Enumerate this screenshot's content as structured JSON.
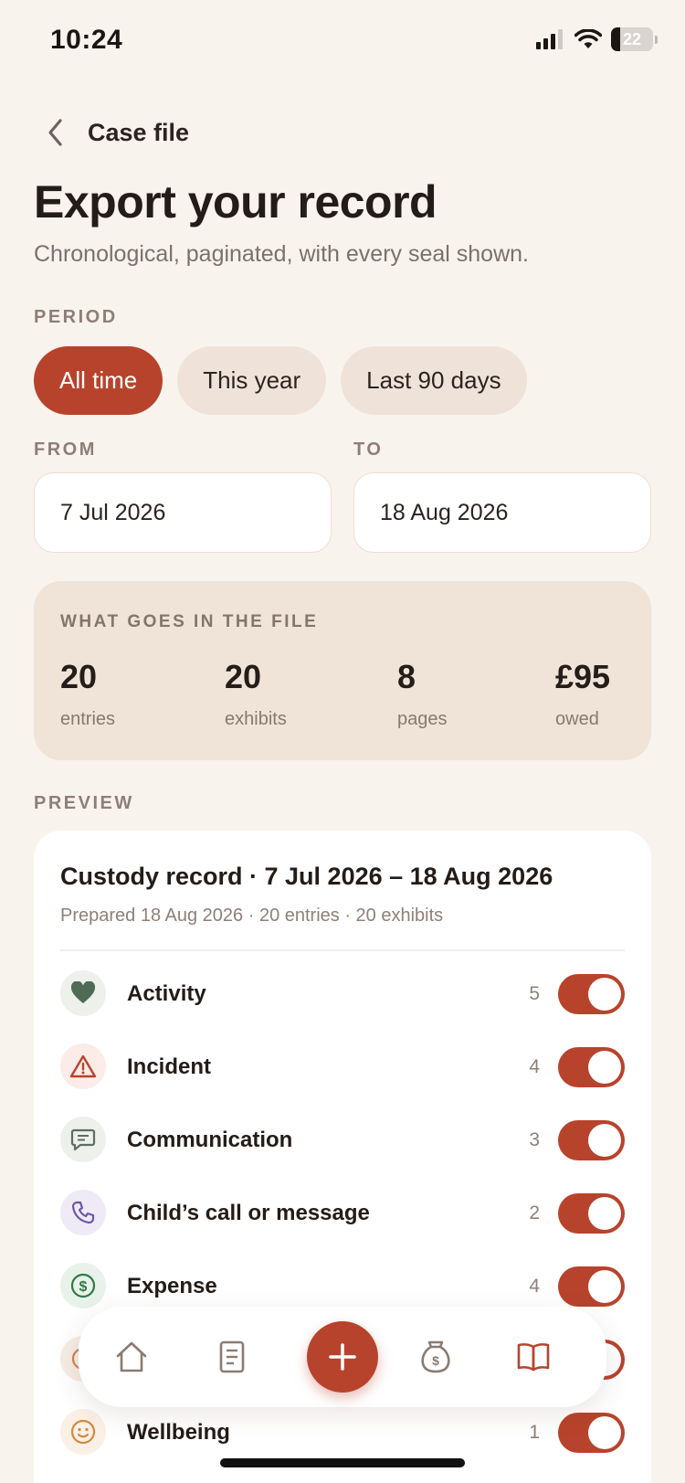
{
  "status_bar": {
    "time": "10:24",
    "battery": "22",
    "battery_fraction": 0.22
  },
  "nav": {
    "back_label": "Case file"
  },
  "page": {
    "title": "Export your record",
    "subtitle": "Chronological, paginated, with every seal shown."
  },
  "period": {
    "label": "PERIOD",
    "options": [
      "All time",
      "This year",
      "Last 90 days"
    ],
    "selected": "All time"
  },
  "range": {
    "from_label": "FROM",
    "from_value": "7 Jul 2026",
    "to_label": "TO",
    "to_value": "18 Aug 2026"
  },
  "summary": {
    "title": "WHAT GOES IN THE FILE",
    "stats": [
      {
        "value": "20",
        "label": "entries"
      },
      {
        "value": "20",
        "label": "exhibits"
      },
      {
        "value": "8",
        "label": "pages"
      },
      {
        "value": "£95",
        "label": "owed"
      }
    ]
  },
  "preview": {
    "label": "PREVIEW",
    "title": "Custody record · 7 Jul 2026 – 18 Aug 2026",
    "meta": "Prepared 18 Aug 2026 · 20 entries · 20 exhibits",
    "categories": [
      {
        "label": "Activity",
        "count": "5",
        "icon": "heart-icon",
        "enabled": true
      },
      {
        "label": "Incident",
        "count": "4",
        "icon": "warning-icon",
        "enabled": true
      },
      {
        "label": "Communication",
        "count": "3",
        "icon": "message-icon",
        "enabled": true
      },
      {
        "label": "Child’s call or message",
        "count": "2",
        "icon": "phone-icon",
        "enabled": true
      },
      {
        "label": "Expense",
        "count": "4",
        "icon": "dollar-icon",
        "enabled": true
      },
      {
        "label": "",
        "count": "",
        "icon": "partially-hidden-icon",
        "enabled": true
      },
      {
        "label": "Wellbeing",
        "count": "1",
        "icon": "smiley-icon",
        "enabled": true
      }
    ]
  },
  "tab_bar": {
    "items": [
      "home-icon",
      "document-icon",
      "add-icon",
      "money-bag-icon",
      "book-icon"
    ],
    "active": "book-icon"
  },
  "colors": {
    "accent": "#b8432c",
    "background": "#f9f3ee",
    "chip_inactive": "#efe3d9",
    "summary_card": "#f0e3d8"
  }
}
